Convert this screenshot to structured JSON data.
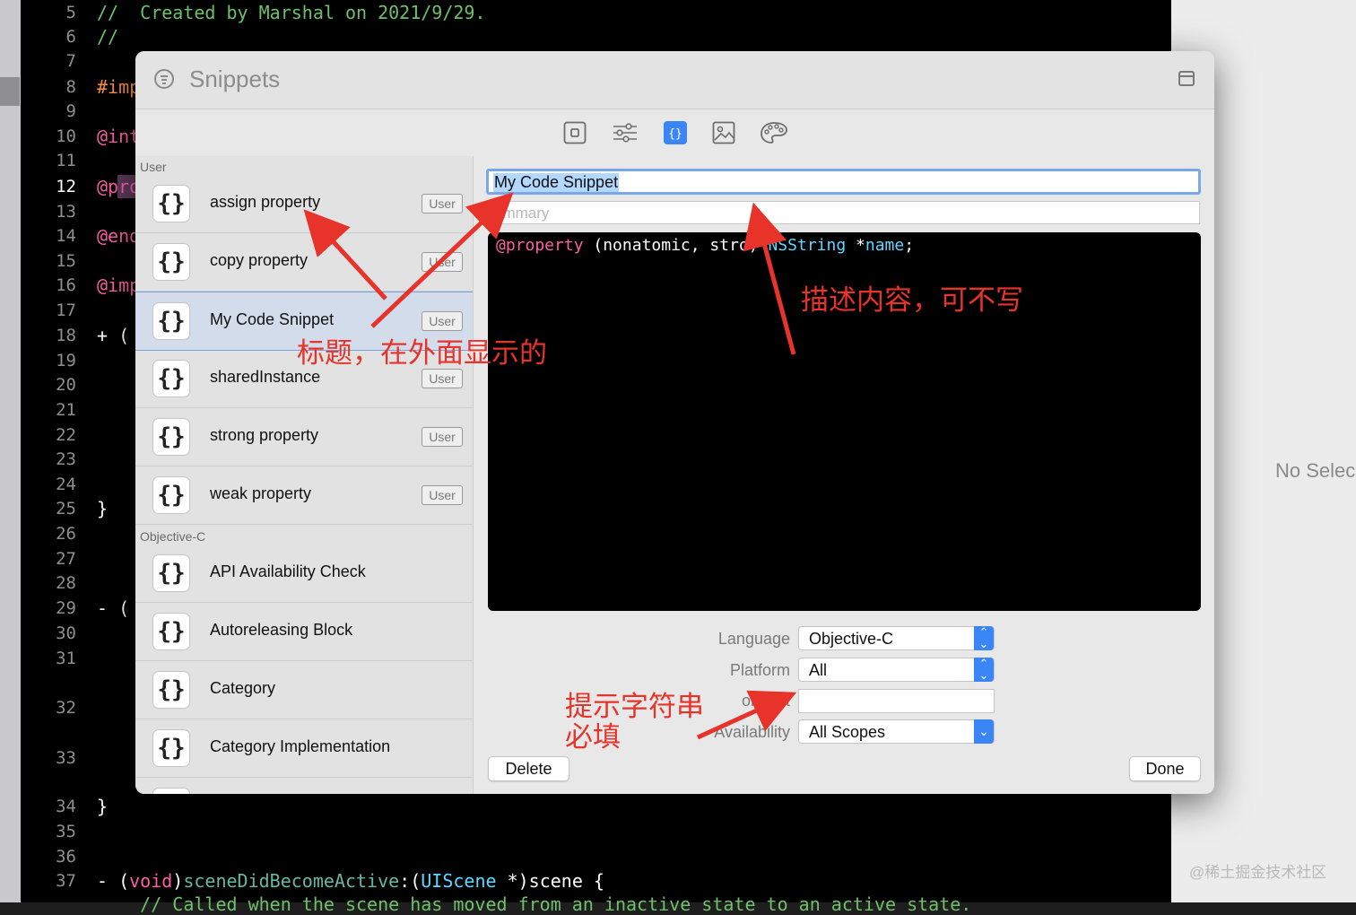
{
  "editor": {
    "lines": [
      {
        "n": "5"
      },
      {
        "n": "6"
      },
      {
        "n": "7"
      },
      {
        "n": "8"
      },
      {
        "n": "9"
      },
      {
        "n": "10"
      },
      {
        "n": "11"
      },
      {
        "n": "12"
      },
      {
        "n": "13"
      },
      {
        "n": "14"
      },
      {
        "n": "15"
      },
      {
        "n": "16"
      },
      {
        "n": "17"
      },
      {
        "n": "18"
      },
      {
        "n": "19"
      },
      {
        "n": "20"
      },
      {
        "n": "21"
      },
      {
        "n": "22"
      },
      {
        "n": "23"
      },
      {
        "n": "24"
      },
      {
        "n": "25"
      },
      {
        "n": "26"
      },
      {
        "n": "27"
      },
      {
        "n": "28"
      },
      {
        "n": "29"
      },
      {
        "n": "30"
      },
      {
        "n": "31"
      },
      {
        "n": "32"
      },
      {
        "n": "33"
      },
      {
        "n": "34"
      },
      {
        "n": "35"
      },
      {
        "n": "36"
      },
      {
        "n": "37"
      }
    ],
    "code": {
      "l5": "//  Created by Marshal on 2021/9/29.",
      "l6": "//",
      "l8": "#imp",
      "l10": "@int",
      "l12": "@pro",
      "l14": "@end",
      "l16": "@imp",
      "l18a": "+ (",
      "l25": "}",
      "l29a": "- (",
      "l34": "}",
      "l37_dash": "- (",
      "l37_void": "void",
      "l37_close": ")",
      "l37_fn": "sceneDidBecomeActive",
      "l37_colon": ":(",
      "l37_type": "UIScene",
      "l37_rest": " *)scene {",
      "l38": "    // Called when the scene has moved from an inactive state to an active state."
    }
  },
  "inspector": {
    "no_selection": "No Selec"
  },
  "watermark": "@稀土掘金技术社区",
  "dialog": {
    "title": "Snippets",
    "toolbar_icons": [
      "file-icon",
      "sliders-icon",
      "braces-icon",
      "image-icon",
      "palette-icon"
    ],
    "sections": {
      "user": "User",
      "objc": "Objective-C"
    },
    "user_items": [
      {
        "label": "assign property",
        "badge": "User"
      },
      {
        "label": "copy property",
        "badge": "User"
      },
      {
        "label": "My Code Snippet",
        "badge": "User"
      },
      {
        "label": "sharedInstance",
        "badge": "User"
      },
      {
        "label": "strong property",
        "badge": "User"
      },
      {
        "label": "weak property",
        "badge": "User"
      }
    ],
    "objc_items": [
      {
        "label": "API Availability Check"
      },
      {
        "label": "Autoreleasing Block"
      },
      {
        "label": "Category"
      },
      {
        "label": "Category Implementation"
      }
    ],
    "icon_glyph": "{}",
    "form": {
      "title_value": "My Code Snippet",
      "summary_placeholder": "Summary",
      "summary_visible": "ummary",
      "code_kw": "@property",
      "code_args": " (nonatomic, stro",
      "code_close": ") ",
      "code_type": "NSString",
      "code_rest": " *",
      "code_name": "name",
      "code_end": ";",
      "language_label": "Language",
      "language_value": "Objective-C",
      "platform_label": "Platform",
      "platform_value": "All",
      "completion_label": "Completion",
      "completion_visible": "omplet",
      "completion_value": "",
      "availability_label": "Availability",
      "availability_visible": "Availability",
      "availability_value": "All Scopes",
      "delete_label": "Delete",
      "done_label": "Done"
    }
  },
  "annotations": {
    "title_note": "标题，在外面显示的",
    "summary_note": "描述内容，可不写",
    "completion_note_1": "提示字符串",
    "completion_note_2": "必填",
    "color": "#e8332a"
  }
}
